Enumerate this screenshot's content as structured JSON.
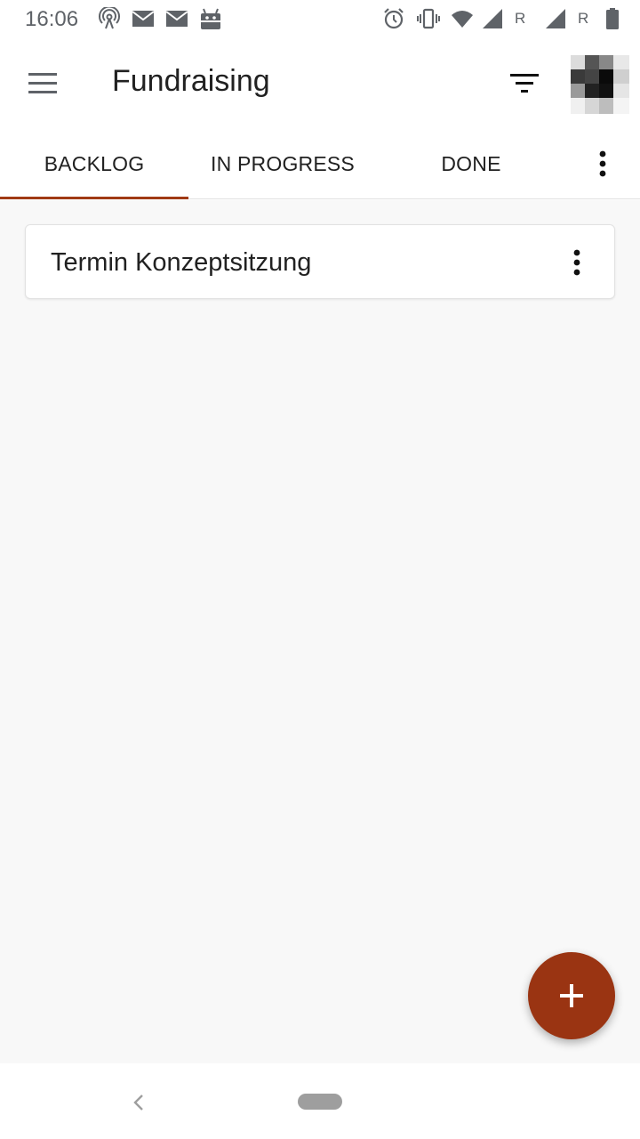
{
  "status_bar": {
    "time": "16:06",
    "icons": [
      "hotspot-icon",
      "mail-icon",
      "mail-icon",
      "android-icon",
      "alarm-icon",
      "vibrate-icon",
      "wifi-icon",
      "signal-icon",
      "signal-icon",
      "battery-icon"
    ],
    "roaming_1": "R",
    "roaming_2": "R"
  },
  "app_bar": {
    "title": "Fundraising",
    "menu_icon": "hamburger-menu-icon",
    "filter_icon": "filter-icon",
    "avatar": "avatar"
  },
  "tabs": {
    "items": [
      {
        "label": "BACKLOG",
        "selected": true
      },
      {
        "label": "IN PROGRESS",
        "selected": false
      },
      {
        "label": "DONE",
        "selected": false
      }
    ],
    "more_icon": "more-vert-icon"
  },
  "cards": [
    {
      "title": "Termin Konzeptsitzung"
    }
  ],
  "fab": {
    "icon": "plus-icon"
  },
  "colors": {
    "accent": "#9a3412",
    "indicator": "#a03a14",
    "background": "#f8f8f8",
    "text": "#212121"
  }
}
